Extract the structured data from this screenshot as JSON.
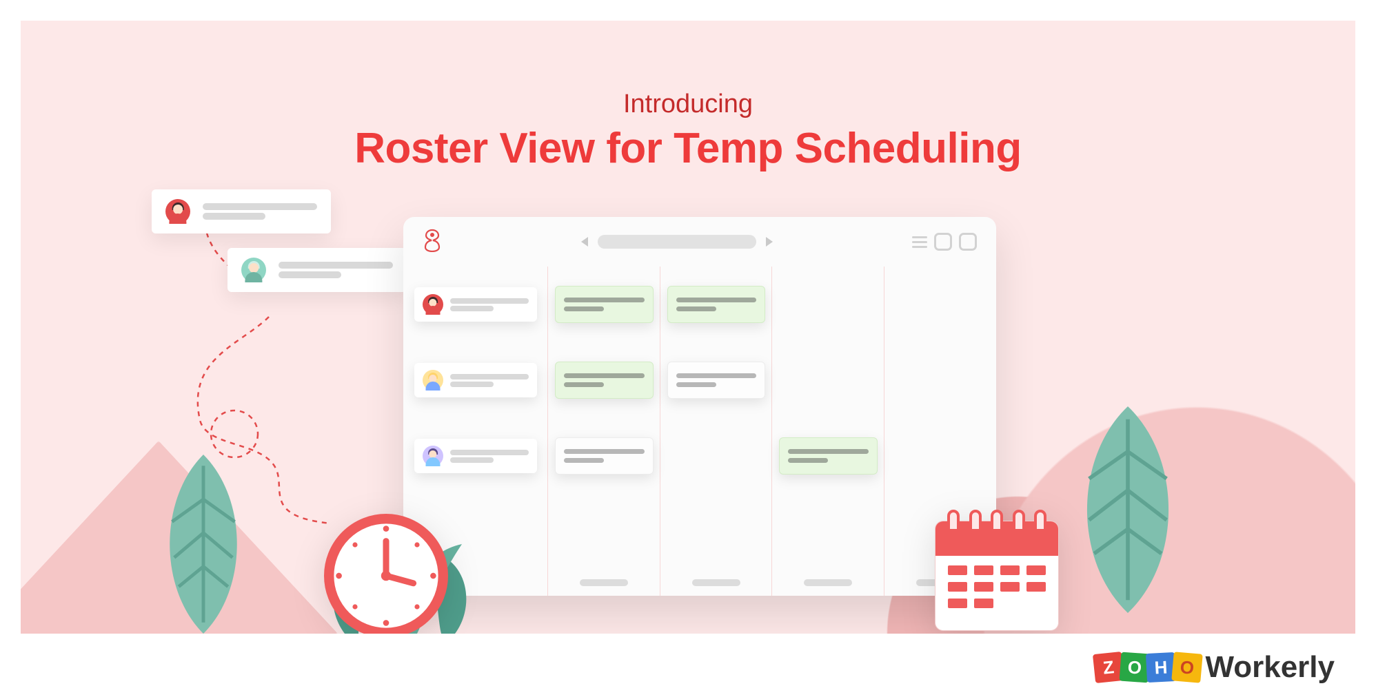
{
  "hero": {
    "intro": "Introducing",
    "headline": "Roster View for Temp Scheduling"
  },
  "brand": {
    "company": "ZOHO",
    "product": "Workerly"
  },
  "roster": {
    "rows": [
      {
        "avatar": {
          "bg": "#e24b4b",
          "body": "#e24b4b",
          "hair": "#3b2b2b"
        },
        "shifts": [
          {
            "col": 1,
            "style": "green"
          },
          {
            "col": 2,
            "style": "green"
          }
        ]
      },
      {
        "avatar": {
          "bg": "#ffd36b",
          "body": "#7aa8ff",
          "hair": "#ffd36b"
        },
        "shifts": [
          {
            "col": 1,
            "style": "green"
          },
          {
            "col": 2,
            "style": "grey"
          }
        ]
      },
      {
        "avatar": {
          "bg": "#b9a7ff",
          "body": "#82c8ff",
          "hair": "#5b4b8a"
        },
        "shifts": [
          {
            "col": 1,
            "style": "grey"
          },
          {
            "col": 3,
            "style": "green"
          }
        ]
      }
    ]
  },
  "floaters": [
    {
      "avatar": {
        "bg": "#e24b4b",
        "body": "#e24b4b",
        "hair": "#3b2b2b"
      }
    },
    {
      "avatar": {
        "bg": "#8fd6c4",
        "body": "#6fb4a2",
        "hair": "#cfeee6"
      }
    }
  ]
}
